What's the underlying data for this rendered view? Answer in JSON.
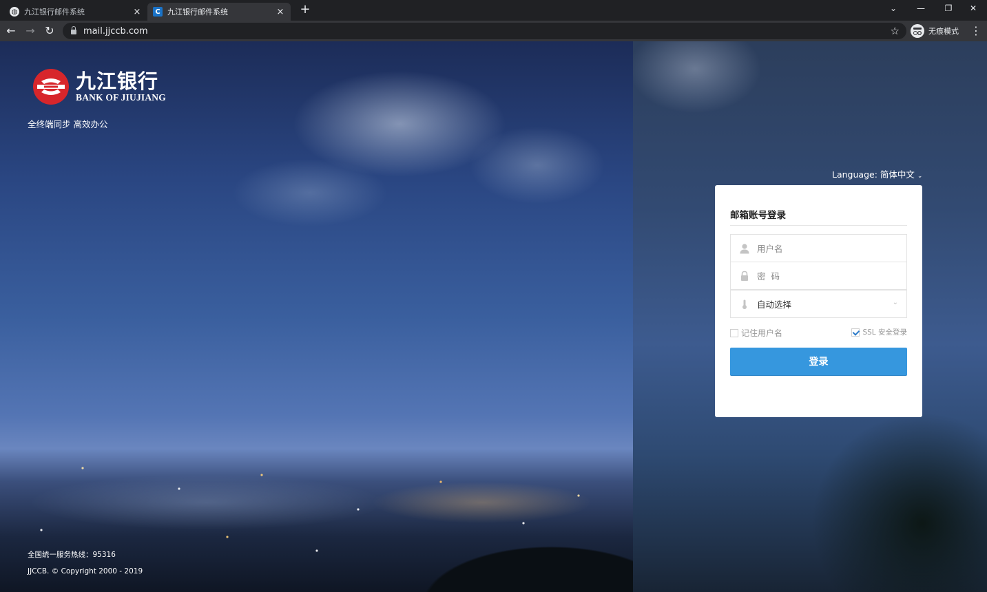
{
  "browser": {
    "tabs": [
      {
        "title": "九江银行邮件系统",
        "favicon": "globe-icon",
        "active": false
      },
      {
        "title": "九江银行邮件系统",
        "favicon": "c-favicon-icon",
        "active": true
      }
    ],
    "url": "mail.jjccb.com",
    "incognito_label": "无痕模式",
    "icons": {
      "close": "×",
      "newtab": "+",
      "back": "←",
      "forward": "→",
      "reload": "↻",
      "star": "☆",
      "menu": "⋮",
      "chevron_down": "⌄",
      "minimize": "—",
      "restore": "❐",
      "window_close": "✕"
    }
  },
  "brand": {
    "name_cn": "九江银行",
    "name_en": "BANK OF JIUJIANG",
    "slogan": "全终端同步 高效办公",
    "logo_color": "#d7262b"
  },
  "footer": {
    "hotline": "全国统一服务热线：95316",
    "copyright": "JJCCB. © Copyright 2000 - 2019"
  },
  "language": {
    "label": "Language: 简体中文",
    "chevron": "⌄"
  },
  "login": {
    "title": "邮箱账号登录",
    "username_placeholder": "用户名",
    "password_placeholder": "密  码",
    "server_select": "自动选择",
    "remember_label": "记住用户名",
    "remember_checked": false,
    "ssl_label": "SSL 安全登录",
    "ssl_checked": true,
    "submit_label": "登录",
    "accent": "#3697de"
  }
}
